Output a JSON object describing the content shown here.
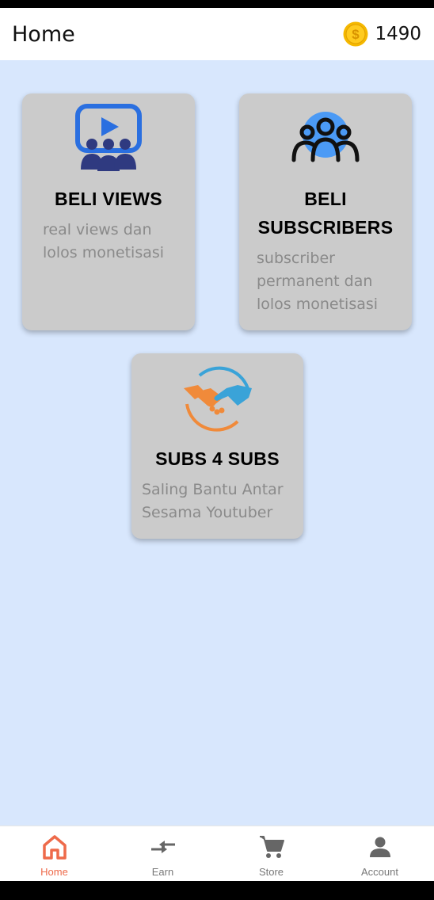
{
  "header": {
    "title": "Home",
    "coins": "1490",
    "coin_icon": "coin-icon"
  },
  "cards": [
    {
      "title": "BELI VIEWS",
      "desc_lines": [
        "real views dan",
        "lolos monetisasi"
      ],
      "icon": "video-audience-icon"
    },
    {
      "title_lines": [
        "BELI",
        "SUBSCRIBERS"
      ],
      "desc_lines": [
        "subscriber",
        "permanent dan",
        "lolos monetisasi"
      ],
      "icon": "users-group-icon"
    },
    {
      "title": "SUBS 4 SUBS",
      "desc_lines": [
        "Saling Bantu Antar",
        "Sesama Youtuber"
      ],
      "icon": "handshake-icon"
    }
  ],
  "nav": [
    {
      "label": "Home",
      "icon": "home-icon",
      "active": true
    },
    {
      "label": "Earn",
      "icon": "exchange-icon",
      "active": false
    },
    {
      "label": "Store",
      "icon": "cart-icon",
      "active": false
    },
    {
      "label": "Account",
      "icon": "person-icon",
      "active": false
    }
  ],
  "colors": {
    "background": "#d8e7fd",
    "card": "#cbcbcb",
    "accent": "#ee6a4a",
    "coin": "#f5b800"
  }
}
